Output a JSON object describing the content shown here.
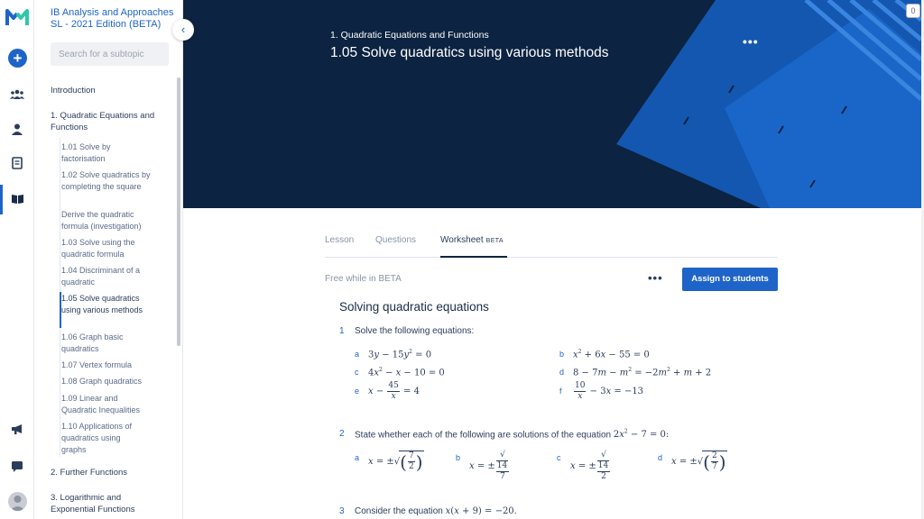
{
  "course": {
    "title": "IB Analysis and Approaches SL - 2021 Edition (BETA)"
  },
  "search": {
    "placeholder": "Search for a subtopic"
  },
  "sidebar": {
    "intro": "Introduction",
    "chapter1": "1. Quadratic Equations and Functions",
    "subtopics": [
      "1.01 Solve by factorisation",
      "1.02 Solve quadratics by completing the square",
      "Derive the quadratic formula (investigation)",
      "1.03 Solve using the quadratic formula",
      "1.04 Discriminant of a quadratic",
      "1.05 Solve quadratics using various methods",
      "1.06 Graph basic quadratics",
      "1.07 Vertex formula",
      "1.08 Graph quadratics",
      "1.09 Linear and Quadratic Inequalities",
      "1.10 Applications of quadratics using graphs"
    ],
    "chapter2": "2. Further Functions",
    "chapter3": "3. Logarithmic and Exponential Functions"
  },
  "rail": {
    "icons": [
      "plus-icon",
      "people-icon",
      "person-icon",
      "notebook-icon",
      "book-icon",
      "megaphone-icon",
      "chat-icon"
    ],
    "badge": "0"
  },
  "banner": {
    "crumb": "1. Quadratic Equations and Functions",
    "title": "1.05 Solve quadratics using various methods",
    "dots": "•••",
    "accent": "#1e64c8",
    "bg": "#0c2341"
  },
  "tabs": {
    "lesson": "Lesson",
    "questions": "Questions",
    "worksheet": "Worksheet",
    "beta": "BETA"
  },
  "worksheet": {
    "free": "Free while in BETA",
    "dots": "•••",
    "assign": "Assign to students",
    "title": "Solving quadratic equations",
    "q1": {
      "num": "1",
      "text": "Solve the following equations:"
    },
    "q2": {
      "num": "2",
      "text": "State whether each of the following are solutions of the equation"
    },
    "q3": {
      "num": "3",
      "text": "Consider the equation"
    },
    "labels": {
      "a": "a",
      "b": "b",
      "c": "c",
      "d": "d",
      "e": "e",
      "f": "f"
    }
  }
}
